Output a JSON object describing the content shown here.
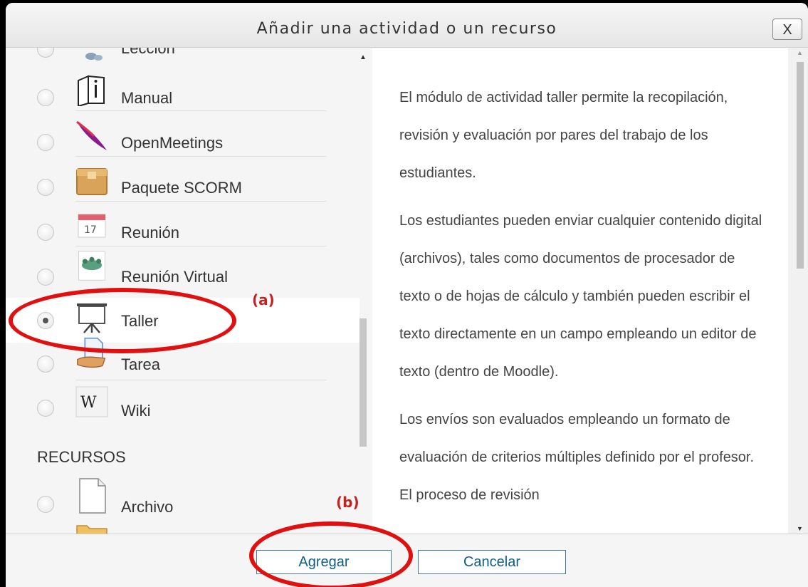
{
  "dialog": {
    "title": "Añadir una actividad o un recurso",
    "close_label": "X"
  },
  "activities": [
    {
      "label": "Lección",
      "icon": "lesson-icon",
      "selected": false
    },
    {
      "label": "Manual",
      "icon": "book-icon",
      "selected": false
    },
    {
      "label": "OpenMeetings",
      "icon": "feather-icon",
      "selected": false
    },
    {
      "label": "Paquete SCORM",
      "icon": "package-icon",
      "selected": false
    },
    {
      "label": "Reunión",
      "icon": "calendar-icon",
      "selected": false
    },
    {
      "label": "Reunión Virtual",
      "icon": "meeting-icon",
      "selected": false
    },
    {
      "label": "Taller",
      "icon": "presentation-board-icon",
      "selected": true
    },
    {
      "label": "Tarea",
      "icon": "assignment-icon",
      "selected": false
    },
    {
      "label": "Wiki",
      "icon": "wiki-icon",
      "selected": false
    }
  ],
  "resources_heading": "RECURSOS",
  "resources": [
    {
      "label": "Archivo",
      "icon": "file-icon",
      "selected": false
    },
    {
      "label": "",
      "icon": "folder-icon",
      "selected": false
    }
  ],
  "description": [
    "El módulo de actividad taller permite la recopilación, revisión y evaluación por pares del trabajo de los estudiantes.",
    "Los estudiantes pueden enviar cualquier contenido digital (archivos), tales como documentos de procesador de texto o de hojas de cálculo y también pueden escribir el texto directamente en un campo empleando un editor de texto (dentro de Moodle).",
    "Los envíos son evaluados empleando un formato de evaluación de criterios múltiples definido por el profesor. El proceso de revisión"
  ],
  "footer": {
    "add_label": "Agregar",
    "cancel_label": "Cancelar"
  },
  "annotations": {
    "a": "(a)",
    "b": "(b)",
    "color": "#e01010"
  }
}
